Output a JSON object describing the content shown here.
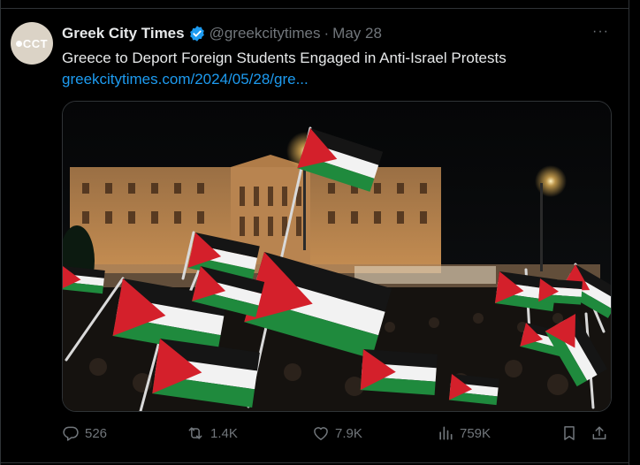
{
  "tweet": {
    "avatar_text": "CCT",
    "name": "Greek City Times",
    "handle": "@greekcitytimes",
    "separator": "·",
    "date": "May 28",
    "text": "Greece to Deport Foreign Students Engaged in Anti-Israel Protests",
    "link": "greekcitytimes.com/2024/05/28/gre...",
    "more": "···"
  },
  "actions": {
    "replies": "526",
    "reposts": "1.4K",
    "likes": "7.9K",
    "views": "759K"
  },
  "colors": {
    "background": "#000000",
    "text": "#e7e9ea",
    "muted": "#71767b",
    "link": "#1d9bf0",
    "verified": "#1d9bf0"
  },
  "icons": [
    "verified-badge-icon",
    "more-icon",
    "reply-icon",
    "repost-icon",
    "like-icon",
    "views-icon",
    "bookmark-icon",
    "share-icon"
  ]
}
